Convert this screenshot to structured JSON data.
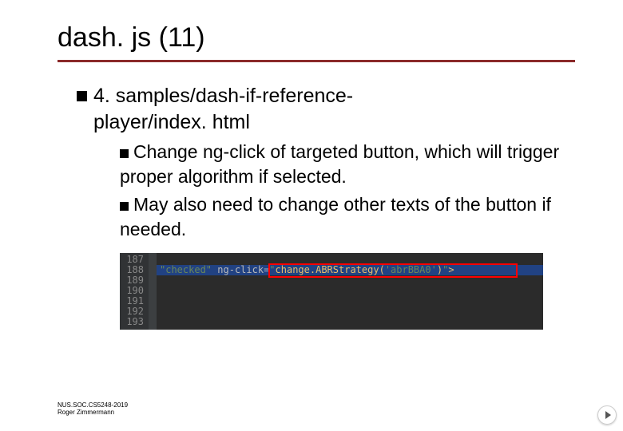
{
  "title": "dash. js (11)",
  "bullet1": {
    "text_a": "4. samples/dash-if-reference-",
    "text_b": "player/index. html"
  },
  "sub1": {
    "lead": "Change",
    "rest": " ng-click of targeted button, which will trigger proper algorithm if selected."
  },
  "sub2": {
    "lead": "May",
    "rest": " also need to change other texts of the button if needed."
  },
  "code": {
    "lines": [
      "187",
      "188",
      "189",
      "190",
      "191",
      "192",
      "193"
    ],
    "checked": "\"checked\"",
    "attr": "ng-click",
    "eq": "=",
    "q1": "\"",
    "fn": "change.ABRStrategy(",
    "arg": "'abrBBA0'",
    "fn2": ")",
    "q2": "\"",
    "tagend": ">"
  },
  "footer": {
    "line1": "NUS.SOC.CS5248-2019",
    "line2": "Roger Zimmermann"
  }
}
